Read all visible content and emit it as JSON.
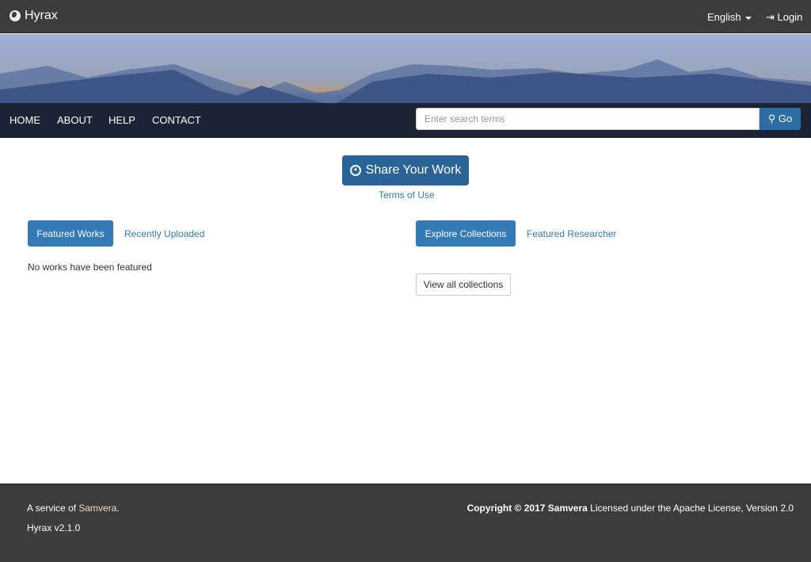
{
  "header": {
    "brand": "Hyrax",
    "language": "English",
    "login": "Login"
  },
  "nav": {
    "items": [
      "HOME",
      "ABOUT",
      "HELP",
      "CONTACT"
    ],
    "search_placeholder": "Enter search terms",
    "go": "Go"
  },
  "main": {
    "share": "Share Your Work",
    "terms": "Terms of Use",
    "left_tabs": [
      "Featured Works",
      "Recently Uploaded"
    ],
    "no_works": "No works have been featured",
    "right_tabs": [
      "Explore Collections",
      "Featured Researcher"
    ],
    "view_all": "View all collections"
  },
  "footer": {
    "service_prefix": "A service of ",
    "service_link": "Samvera",
    "service_suffix": ".",
    "version": "Hyrax v2.1.0",
    "copyright": "Copyright © 2017 Samvera",
    "license": " Licensed under the Apache License, Version 2.0"
  },
  "colors": {
    "primary": "#337ab7",
    "topbar": "#3c3c3c"
  }
}
